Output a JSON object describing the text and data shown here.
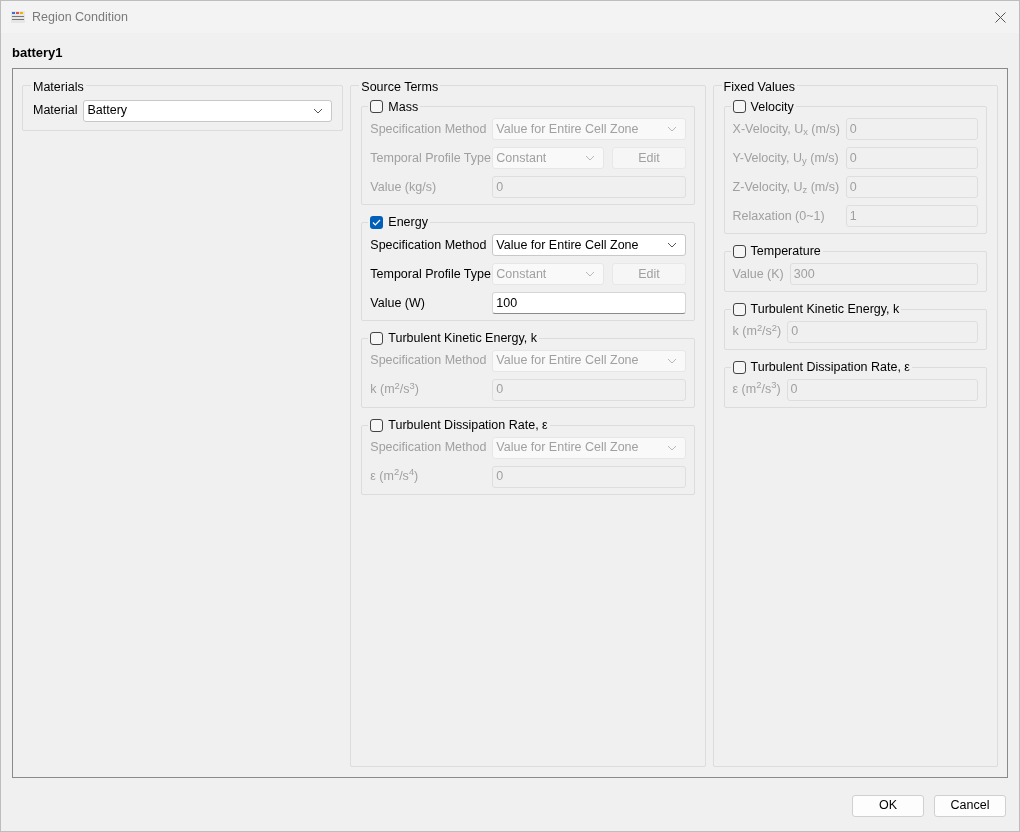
{
  "window": {
    "title": "Region Condition"
  },
  "region_name": "battery1",
  "materials": {
    "title": "Materials",
    "label": "Material",
    "value": "Battery"
  },
  "source_terms": {
    "title": "Source Terms",
    "groups": [
      {
        "label": "Mass",
        "checked": false,
        "rows": [
          {
            "kind": "select",
            "label": "Specification Method",
            "value": "Value for Entire Cell Zone",
            "disabled": true
          },
          {
            "kind": "select-edit",
            "label": "Temporal Profile Type",
            "value": "Constant",
            "button": "Edit",
            "disabled": true
          },
          {
            "kind": "input",
            "label": "Value (kg/s)",
            "value": "0",
            "disabled": true
          }
        ]
      },
      {
        "label": "Energy",
        "checked": true,
        "rows": [
          {
            "kind": "select",
            "label": "Specification Method",
            "value": "Value for Entire Cell Zone",
            "disabled": false
          },
          {
            "kind": "select-edit",
            "label": "Temporal Profile Type",
            "value": "Constant",
            "button": "Edit",
            "disabled": true
          },
          {
            "kind": "input",
            "label": "Value (W)",
            "value": "100",
            "disabled": false
          }
        ]
      },
      {
        "label": "Turbulent Kinetic Energy, k",
        "checked": false,
        "rows": [
          {
            "kind": "select",
            "label": "Specification Method",
            "value": "Value for Entire Cell Zone",
            "disabled": true
          },
          {
            "kind": "input",
            "label": "k (m$^{2}$/s$^{3}$)",
            "value": "0",
            "disabled": true
          }
        ]
      },
      {
        "label": "Turbulent Dissipation Rate, ε",
        "checked": false,
        "rows": [
          {
            "kind": "select",
            "label": "Specification Method",
            "value": "Value for Entire Cell Zone",
            "disabled": true
          },
          {
            "kind": "input",
            "label": "ε (m$^{2}$/s$^{4}$)",
            "value": "0",
            "disabled": true
          }
        ]
      }
    ]
  },
  "fixed_values": {
    "title": "Fixed Values",
    "groups": [
      {
        "label": "Velocity",
        "checked": false,
        "rows": [
          {
            "kind": "input",
            "label": "X-Velocity, U$_{x}$ (m/s)",
            "value": "0",
            "disabled": true
          },
          {
            "kind": "input",
            "label": "Y-Velocity, U$_{y}$ (m/s)",
            "value": "0",
            "disabled": true
          },
          {
            "kind": "input",
            "label": "Z-Velocity, U$_{z}$ (m/s)",
            "value": "0",
            "disabled": true
          },
          {
            "kind": "input",
            "label": "Relaxation (0~1)",
            "value": "1",
            "disabled": true
          }
        ]
      },
      {
        "label": "Temperature",
        "checked": false,
        "rows": [
          {
            "kind": "input",
            "label": "Value (K)",
            "value": "300",
            "disabled": true
          }
        ]
      },
      {
        "label": "Turbulent Kinetic Energy, k",
        "checked": false,
        "rows": [
          {
            "kind": "input",
            "label": "k (m$^{2}$/s$^{2}$)",
            "value": "0",
            "disabled": true
          }
        ]
      },
      {
        "label": "Turbulent Dissipation Rate, ε",
        "checked": false,
        "rows": [
          {
            "kind": "input",
            "label": "ε (m$^{2}$/s$^{3}$)",
            "value": "0",
            "disabled": true
          }
        ]
      }
    ]
  },
  "buttons": [
    {
      "label": "OK"
    },
    {
      "label": "Cancel"
    }
  ]
}
